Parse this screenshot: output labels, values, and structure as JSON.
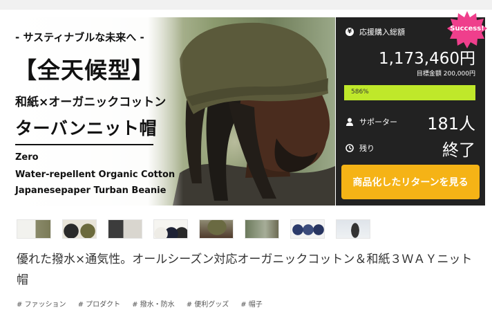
{
  "hero": {
    "subtitle": "- サスティナブルな未来へ -",
    "title": "【全天候型】",
    "line1": "和紙×オーガニックコットン",
    "line2": "ターバンニット帽",
    "en_line1": "Zero",
    "en_line2": "Water-repellent Organic Cotton",
    "en_line3": "Japanesepaper Turban Beanie"
  },
  "panel": {
    "total_label": "応援購入総額",
    "total_amount": "1,173,460円",
    "goal_text": "目標金額 200,000円",
    "progress_percent": 586,
    "progress_text": "586%",
    "supporters_label": "サポーター",
    "supporters_value": "181人",
    "remaining_label": "残り",
    "remaining_value": "終了",
    "cta_label": "商品化したリターンを見る",
    "badge": "Success!",
    "colors": {
      "background": "#222222",
      "progress": "#bfe82a",
      "cta": "#f5b316",
      "badge": "#ef3f8c"
    }
  },
  "thumbnails": [
    {
      "name": "thumb-1",
      "icon": "collage"
    },
    {
      "name": "thumb-2",
      "icon": "two-beanies"
    },
    {
      "name": "thumb-3",
      "icon": "two-models"
    },
    {
      "name": "thumb-4",
      "icon": "beanies-lineup"
    },
    {
      "name": "thumb-5",
      "icon": "model-closeup"
    },
    {
      "name": "thumb-6",
      "icon": "model-outdoor"
    },
    {
      "name": "thumb-7",
      "icon": "blue-beanies"
    },
    {
      "name": "thumb-8",
      "icon": "golfer"
    }
  ],
  "description": "優れた撥水×通気性。オールシーズン対応オーガニックコットン＆和紙３ＷＡＹニット帽",
  "tags": [
    "# ファッション",
    "# プロダクト",
    "# 撥水・防水",
    "# 便利グッズ",
    "# 帽子"
  ]
}
